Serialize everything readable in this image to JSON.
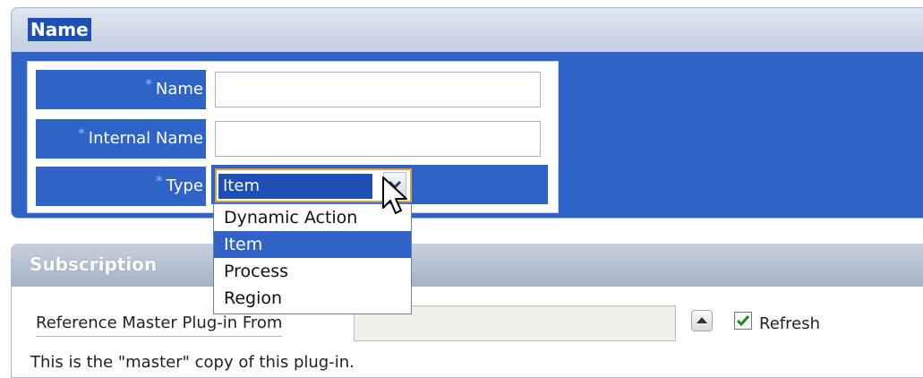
{
  "name_region": {
    "title": "Name",
    "fields": [
      {
        "label": "Name",
        "required_marker": "*",
        "value": ""
      },
      {
        "label": "Internal Name",
        "required_marker": "*",
        "value": ""
      },
      {
        "label": "Type",
        "required_marker": "*",
        "selected": "Item"
      }
    ],
    "type_options": [
      "Dynamic Action",
      "Item",
      "Process",
      "Region"
    ],
    "highlighted_option": "Item"
  },
  "subscription_region": {
    "title": "Subscription",
    "reference_label": "Reference Master Plug-in From",
    "reference_value": "",
    "refresh_label": "Refresh",
    "refresh_checked": true,
    "help_text": "This is the \"master\" copy of this plug-in."
  },
  "colors": {
    "accent_blue": "#2f63c7",
    "selection_blue": "#1d4fb5",
    "focus_border": "#d2a63a"
  },
  "icons": [
    "chevron-down-icon",
    "mouse-cursor-icon",
    "up-arrow-icon",
    "checkmark-icon",
    "required-asterisk-icon"
  ]
}
